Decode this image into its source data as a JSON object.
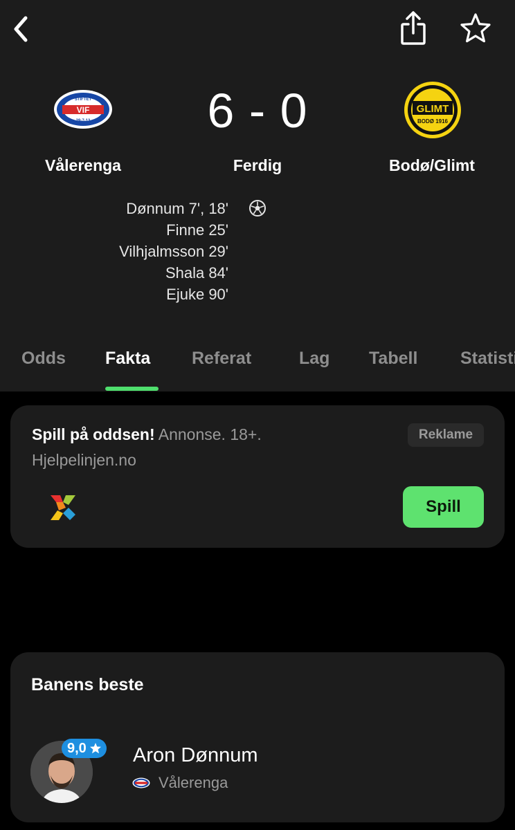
{
  "nav": {
    "back_icon": "chevron-left-icon",
    "share_icon": "share-icon",
    "favorite_icon": "star-outline-icon"
  },
  "match": {
    "home_team": "Vålerenga",
    "away_team": "Bodø/Glimt",
    "score": "6 - 0",
    "status": "Ferdig",
    "home_scorers": [
      "Dønnum 7', 18'",
      "Finne 25'",
      "Vilhjalmsson 29'",
      "Shala 84'",
      "Ejuke 90'"
    ],
    "scorer_icon": "football-icon",
    "home_logo_text": "STIFTET VIF 29-7-13",
    "away_logo_text": "GLIMT BODØ 1916"
  },
  "tabs": [
    "Odds",
    "Fakta",
    "Referat",
    "Lag",
    "Tabell",
    "Statistikk"
  ],
  "active_tab": "Fakta",
  "ad": {
    "headline": "Spill på oddsen!",
    "disclaimer": "Annonse. 18+.",
    "link": "Hjelpelinjen.no",
    "badge": "Reklame",
    "button": "Spill",
    "logo": "betting-brand-logo",
    "accent": "#5ee26f"
  },
  "best_player": {
    "section_title": "Banens beste",
    "name": "Aron Dønnum",
    "team": "Vålerenga",
    "rating": "9,0",
    "rating_icon": "star-icon",
    "rating_color": "#1e8fe0"
  },
  "colors": {
    "background": "#000000",
    "header": "#1c1c1c",
    "card": "#1c1c1c",
    "tab_indicator": "#4fde6d",
    "muted": "#8e8e8e"
  }
}
